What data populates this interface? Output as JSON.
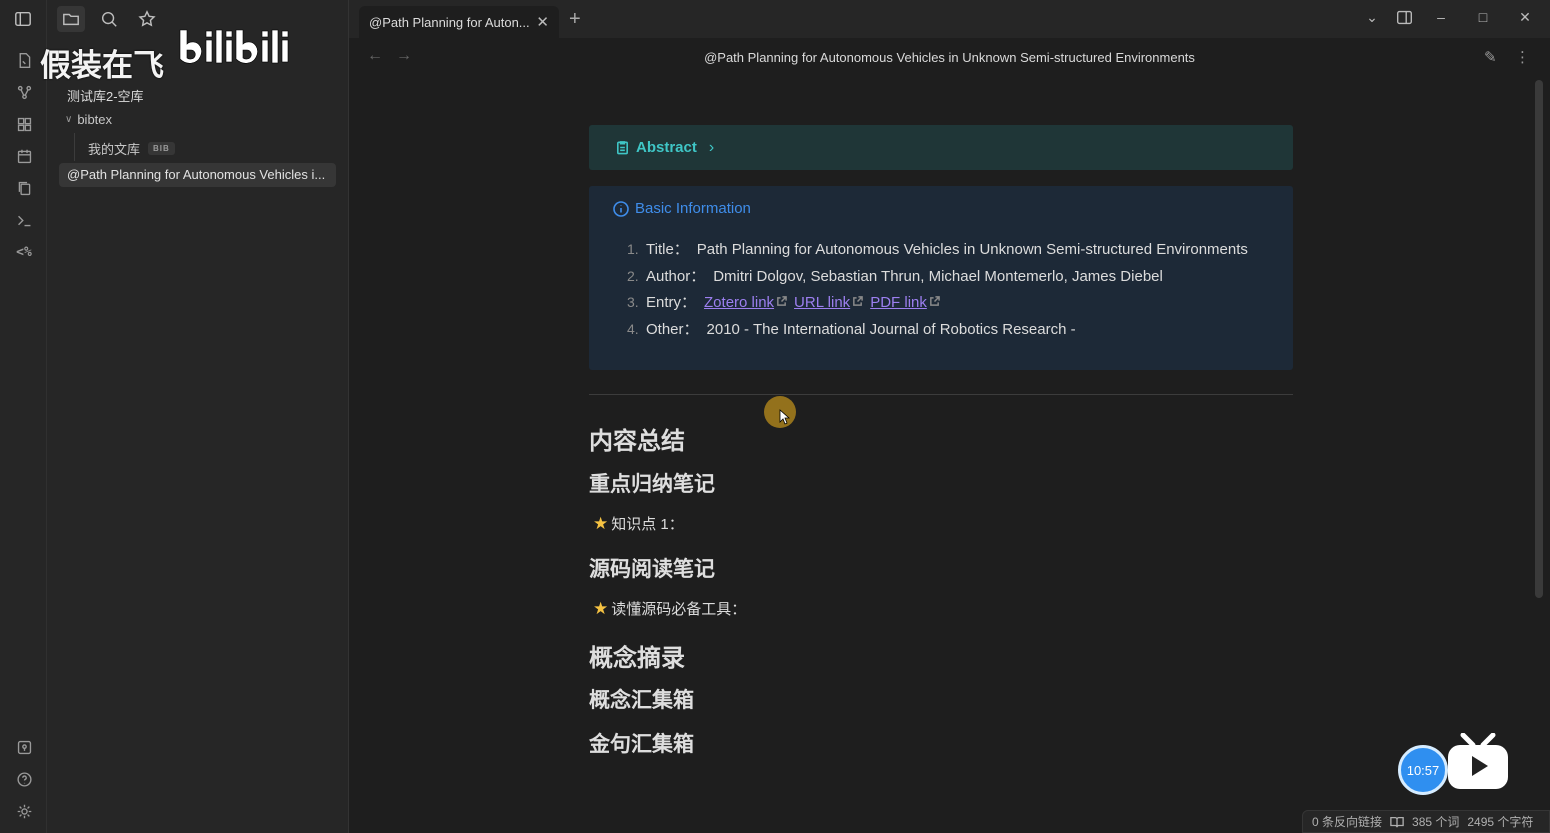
{
  "watermark": {
    "text": "假装在飞",
    "logo_text": "bilibili"
  },
  "sidebar": {
    "vault_name": "测试库2-空库",
    "folder": "bibtex",
    "file": {
      "name": "我的文库",
      "badge": "BIB"
    },
    "active_note": "@Path Planning for Autonomous Vehicles i..."
  },
  "ribbon": {
    "template_label": "<%"
  },
  "tab": {
    "title": "@Path Planning for Auton...",
    "close": "✕",
    "add": "+"
  },
  "window": {
    "dropdown": "⌄",
    "minimize": "–",
    "maximize": "□",
    "close": "✕"
  },
  "view": {
    "back": "←",
    "forward": "→",
    "title": "@Path Planning for Autonomous Vehicles in Unknown Semi-structured Environments",
    "edit": "✎",
    "more": "⋮"
  },
  "note": {
    "abstract_title": "Abstract",
    "basic_title": "Basic Information",
    "items": [
      {
        "num": "1.",
        "label": "Title：",
        "value": "Path Planning for Autonomous Vehicles in Unknown Semi-structured Environments"
      },
      {
        "num": "2.",
        "label": "Author：",
        "value": "Dmitri Dolgov, Sebastian Thrun, Michael Montemerlo, James Diebel"
      },
      {
        "num": "3.",
        "label": "Entry：",
        "links": [
          "Zotero link",
          "URL link",
          "PDF link"
        ]
      },
      {
        "num": "4.",
        "label": "Other：",
        "value": "2010 - The International Journal of Robotics Research -"
      }
    ],
    "h_summary": "内容总结",
    "h_key_notes": "重点归纳笔记",
    "p_knowledge": "知识点 1：",
    "h_source_notes": "源码阅读笔记",
    "p_tools": "读懂源码必备工具：",
    "h_concepts": "概念摘录",
    "h_concept_box": "概念汇集箱",
    "h_quotes": "金句汇集箱",
    "star": "★"
  },
  "player": {
    "time": "10:57"
  },
  "status": {
    "backlinks": "0 条反向链接",
    "words": "385 个词",
    "chars": "2495 个字符"
  },
  "colors": {
    "abstract_accent": "#3fc6c6",
    "info_accent": "#3f8dea",
    "link": "#9c7ff0",
    "star": "#f5c242"
  }
}
